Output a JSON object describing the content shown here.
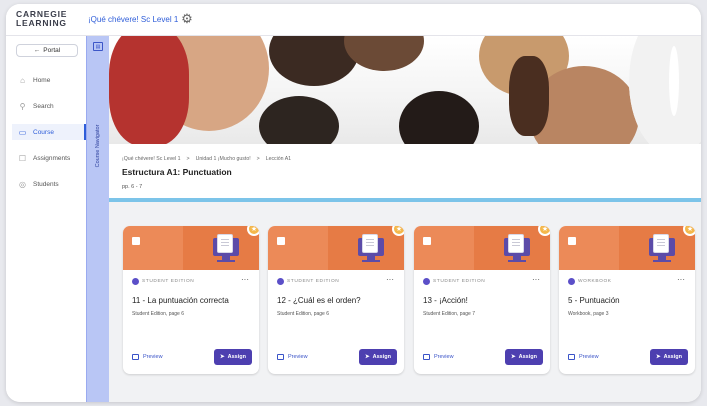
{
  "header": {
    "logo_line1": "CARNEGIE",
    "logo_line2": "LEARNING",
    "course_selector": "¡Qué chévere! Sc Level 1",
    "chevron": "⌄",
    "settings_icon": "gear-icon"
  },
  "sidebar": {
    "portal_label": "Portal",
    "items": [
      {
        "label": "Home",
        "icon": "home-icon"
      },
      {
        "label": "Search",
        "icon": "search-icon"
      },
      {
        "label": "Course",
        "icon": "course-icon",
        "active": true
      },
      {
        "label": "Assignments",
        "icon": "assignments-icon"
      },
      {
        "label": "Students",
        "icon": "students-icon"
      }
    ]
  },
  "course_navigator": {
    "label": "Course Navigator"
  },
  "breadcrumb": [
    "¡Qué chévere! Sc Level 1",
    "Unidad 1 ¡Mucho gusto!",
    "Lección A1"
  ],
  "page": {
    "title": "Estructura A1: Punctuation",
    "pages": "pp. 6 - 7"
  },
  "cards": [
    {
      "edition": "STUDENT EDITION",
      "title": "11 - La puntuación correcta",
      "subtitle": "Student Edition, page 6",
      "preview": "Preview",
      "assign": "Assign"
    },
    {
      "edition": "STUDENT EDITION",
      "title": "12 - ¿Cuál es el orden?",
      "subtitle": "Student Edition, page 6",
      "preview": "Preview",
      "assign": "Assign"
    },
    {
      "edition": "STUDENT EDITION",
      "title": "13 - ¡Acción!",
      "subtitle": "Student Edition, page 7",
      "preview": "Preview",
      "assign": "Assign"
    },
    {
      "edition": "WORKBOOK",
      "title": "5 - Puntuación",
      "subtitle": "Workbook, page 3",
      "preview": "Preview",
      "assign": "Assign"
    }
  ],
  "colors": {
    "accent_blue": "#2f5ed9",
    "card_orange": "#ec8a58",
    "assign_purple": "#4d3fb0",
    "navigator_bg": "#b9c6f5",
    "divider": "#7cc4e9"
  }
}
